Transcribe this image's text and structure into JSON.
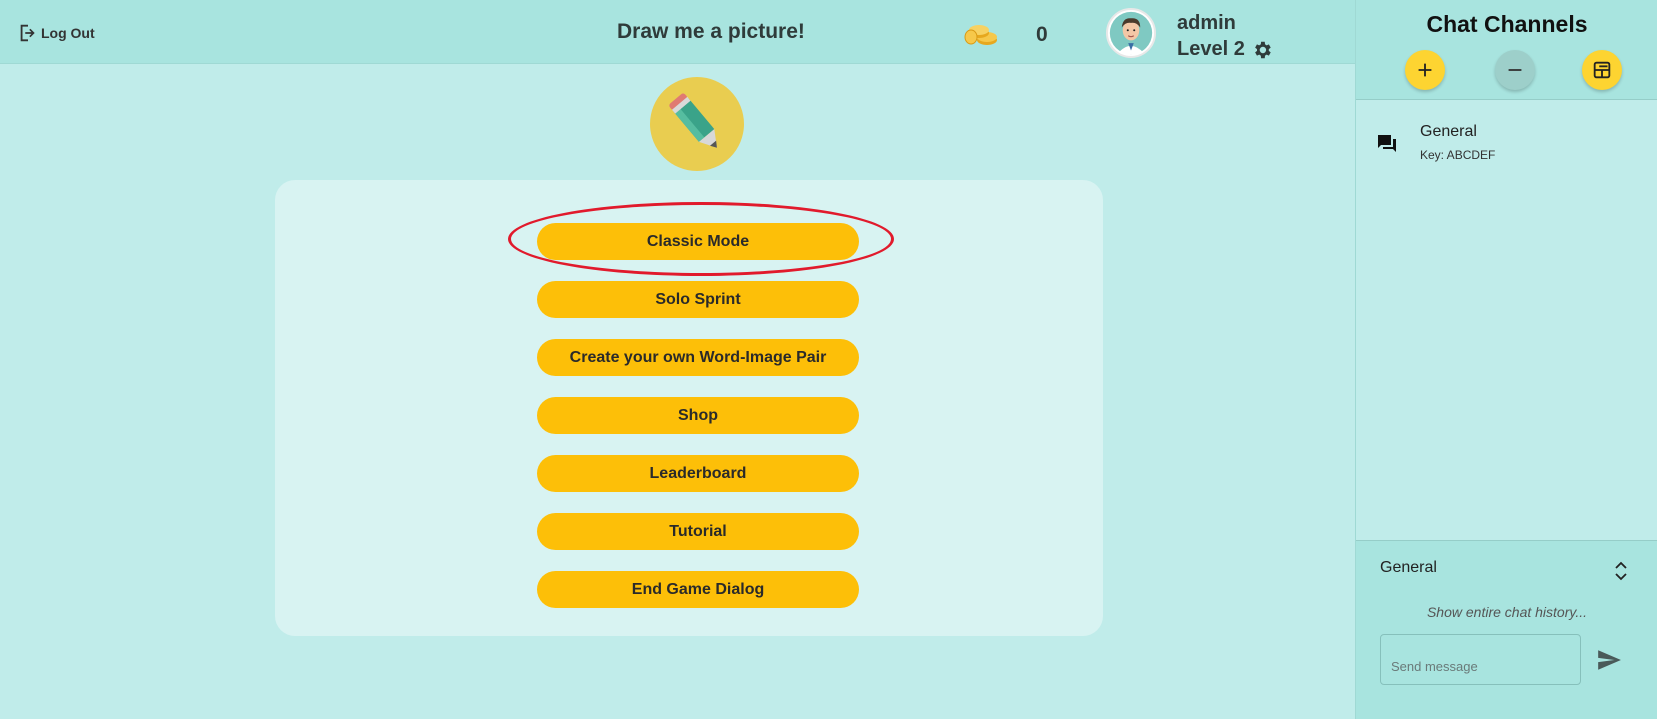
{
  "header": {
    "logout_label": "Log Out",
    "title": "Draw me a picture!",
    "coin_count": "0",
    "username": "admin",
    "level": "Level 2"
  },
  "menu": {
    "buttons": [
      {
        "label": "Classic Mode"
      },
      {
        "label": "Solo Sprint"
      },
      {
        "label": "Create your own Word-Image Pair"
      },
      {
        "label": "Shop"
      },
      {
        "label": "Leaderboard"
      },
      {
        "label": "Tutorial"
      },
      {
        "label": "End Game Dialog"
      }
    ]
  },
  "sidebar": {
    "title": "Chat Channels",
    "channels": [
      {
        "name": "General",
        "key": "Key: ABCDEF"
      }
    ],
    "chat": {
      "current_channel": "General",
      "history_link": "Show entire chat history...",
      "input_placeholder": "Send message"
    }
  },
  "icons": [
    "logout-icon",
    "coins-icon",
    "avatar",
    "gear-icon",
    "pencil-logo",
    "plus-icon",
    "minus-icon",
    "merge-icon",
    "forum-icon",
    "unfold-icon",
    "send-icon"
  ],
  "colors": {
    "background": "#c0ecea",
    "header": "#a8e4df",
    "panel": "#d8f3f2",
    "button": "#fdbf08",
    "highlight": "#e11a2c",
    "logo": "#e9cd50"
  }
}
